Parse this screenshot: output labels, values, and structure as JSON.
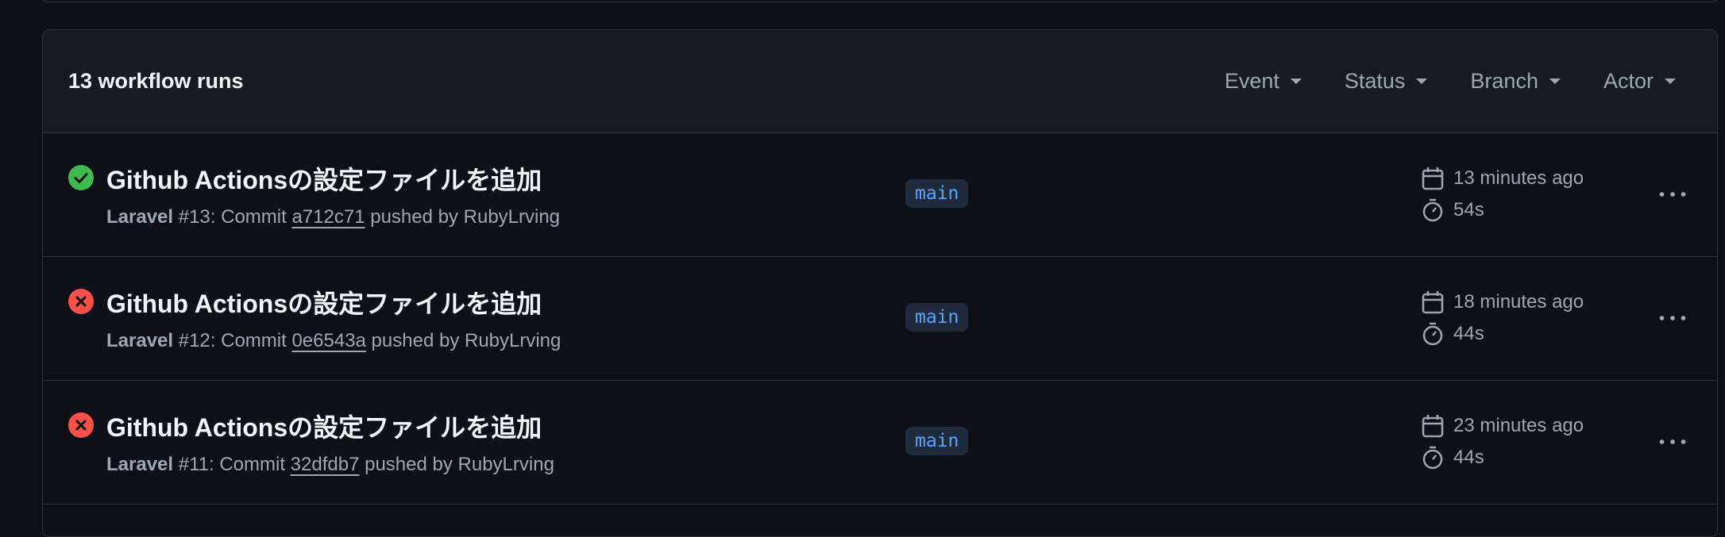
{
  "header": {
    "run_count": "13 workflow runs",
    "filters": [
      {
        "label": "Event"
      },
      {
        "label": "Status"
      },
      {
        "label": "Branch"
      },
      {
        "label": "Actor"
      }
    ]
  },
  "runs": [
    {
      "status": "success",
      "title": "Github Actionsの設定ファイルを追加",
      "workflow": "Laravel",
      "number": "#13",
      "commit_prefix": ": Commit ",
      "sha": "a712c71",
      "pushed_by": " pushed by RubyLrving",
      "branch": "main",
      "when": "13 minutes ago",
      "duration": "54s"
    },
    {
      "status": "failure",
      "title": "Github Actionsの設定ファイルを追加",
      "workflow": "Laravel",
      "number": "#12",
      "commit_prefix": ": Commit ",
      "sha": "0e6543a",
      "pushed_by": " pushed by RubyLrving",
      "branch": "main",
      "when": "18 minutes ago",
      "duration": "44s"
    },
    {
      "status": "failure",
      "title": "Github Actionsの設定ファイルを追加",
      "workflow": "Laravel",
      "number": "#11",
      "commit_prefix": ": Commit ",
      "sha": "32dfdb7",
      "pushed_by": " pushed by RubyLrving",
      "branch": "main",
      "when": "23 minutes ago",
      "duration": "44s"
    }
  ],
  "colors": {
    "background": "#0d1117",
    "header_bg": "#161b22",
    "border": "#30363d",
    "success": "#3fb950",
    "failure": "#f85149",
    "branch_text": "#58a6ff",
    "muted": "#9da7b3"
  },
  "icons": {
    "success": "check-circle-icon",
    "failure": "x-circle-icon",
    "when": "calendar-icon",
    "duration": "stopwatch-icon",
    "menu": "kebab-horizontal-icon",
    "filter": "triangle-down-icon"
  }
}
